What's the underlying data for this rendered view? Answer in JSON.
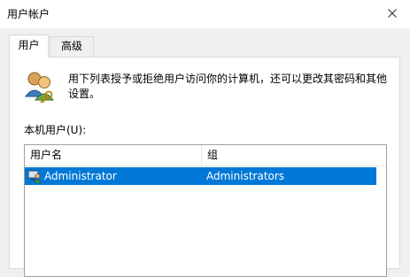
{
  "window": {
    "title": "用户帐户"
  },
  "tabs": [
    {
      "label": "用户"
    },
    {
      "label": "高级"
    }
  ],
  "main": {
    "description": "用下列表授予或拒绝用户访问你的计算机，还可以更改其密码和其他设置。",
    "list_label": "本机用户(U):"
  },
  "table": {
    "columns": [
      "用户名",
      "组"
    ],
    "rows": [
      {
        "username": "Administrator",
        "group": "Administrators",
        "selected": true
      }
    ]
  },
  "colors": {
    "selection": "#0078d7",
    "background": "#f0f0f0"
  },
  "icons": {
    "header": "users-icon",
    "row": "user-computer-icon",
    "close": "close-icon"
  }
}
